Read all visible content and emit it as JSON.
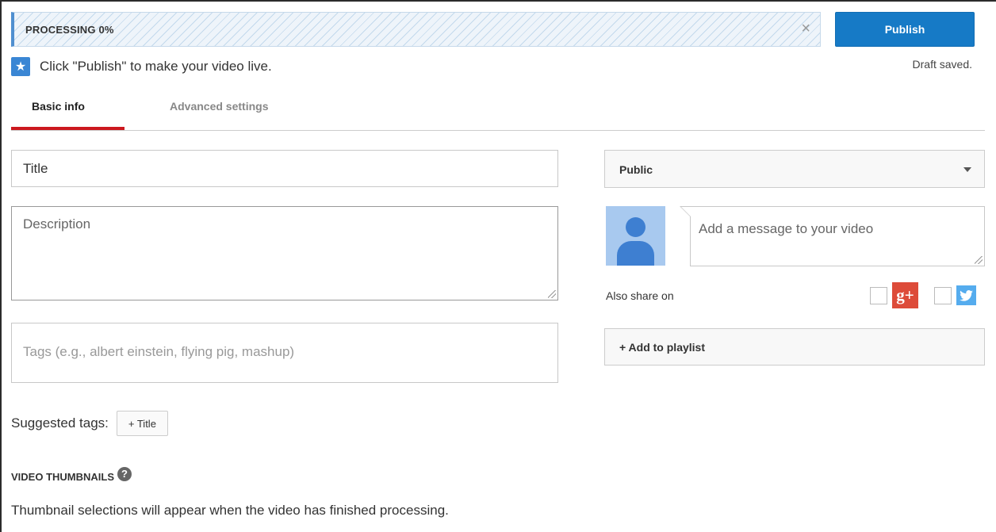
{
  "processing": {
    "label": "PROCESSING 0%",
    "progress_percent": 0,
    "close_glyph": "×"
  },
  "publish": {
    "button_label": "Publish",
    "status": "Draft saved."
  },
  "hint": {
    "icon": "star-icon",
    "icon_glyph": "★",
    "text": "Click \"Publish\" to make your video live."
  },
  "tabs": [
    {
      "label": "Basic info",
      "active": true
    },
    {
      "label": "Advanced settings",
      "active": false
    }
  ],
  "form": {
    "title_value": "Title",
    "description_placeholder": "Description",
    "tags_placeholder": "Tags (e.g., albert einstein, flying pig, mashup)",
    "suggested_label": "Suggested tags:",
    "suggested_chip": "+ Title"
  },
  "thumbnails": {
    "heading": "VIDEO THUMBNAILS",
    "help_glyph": "?",
    "note": "Thumbnail selections will appear when the video has finished processing."
  },
  "privacy": {
    "selected": "Public"
  },
  "share": {
    "message_placeholder": "Add a message to your video",
    "also_share_label": "Also share on",
    "gplus_glyph": "g+",
    "twitter_glyph": "t"
  },
  "playlist": {
    "button_label": "+ Add to playlist"
  },
  "colors": {
    "publish_blue": "#167ac6",
    "tab_active_red": "#cc181e",
    "gplus_red": "#dd4b39",
    "twitter_blue": "#55acee"
  }
}
